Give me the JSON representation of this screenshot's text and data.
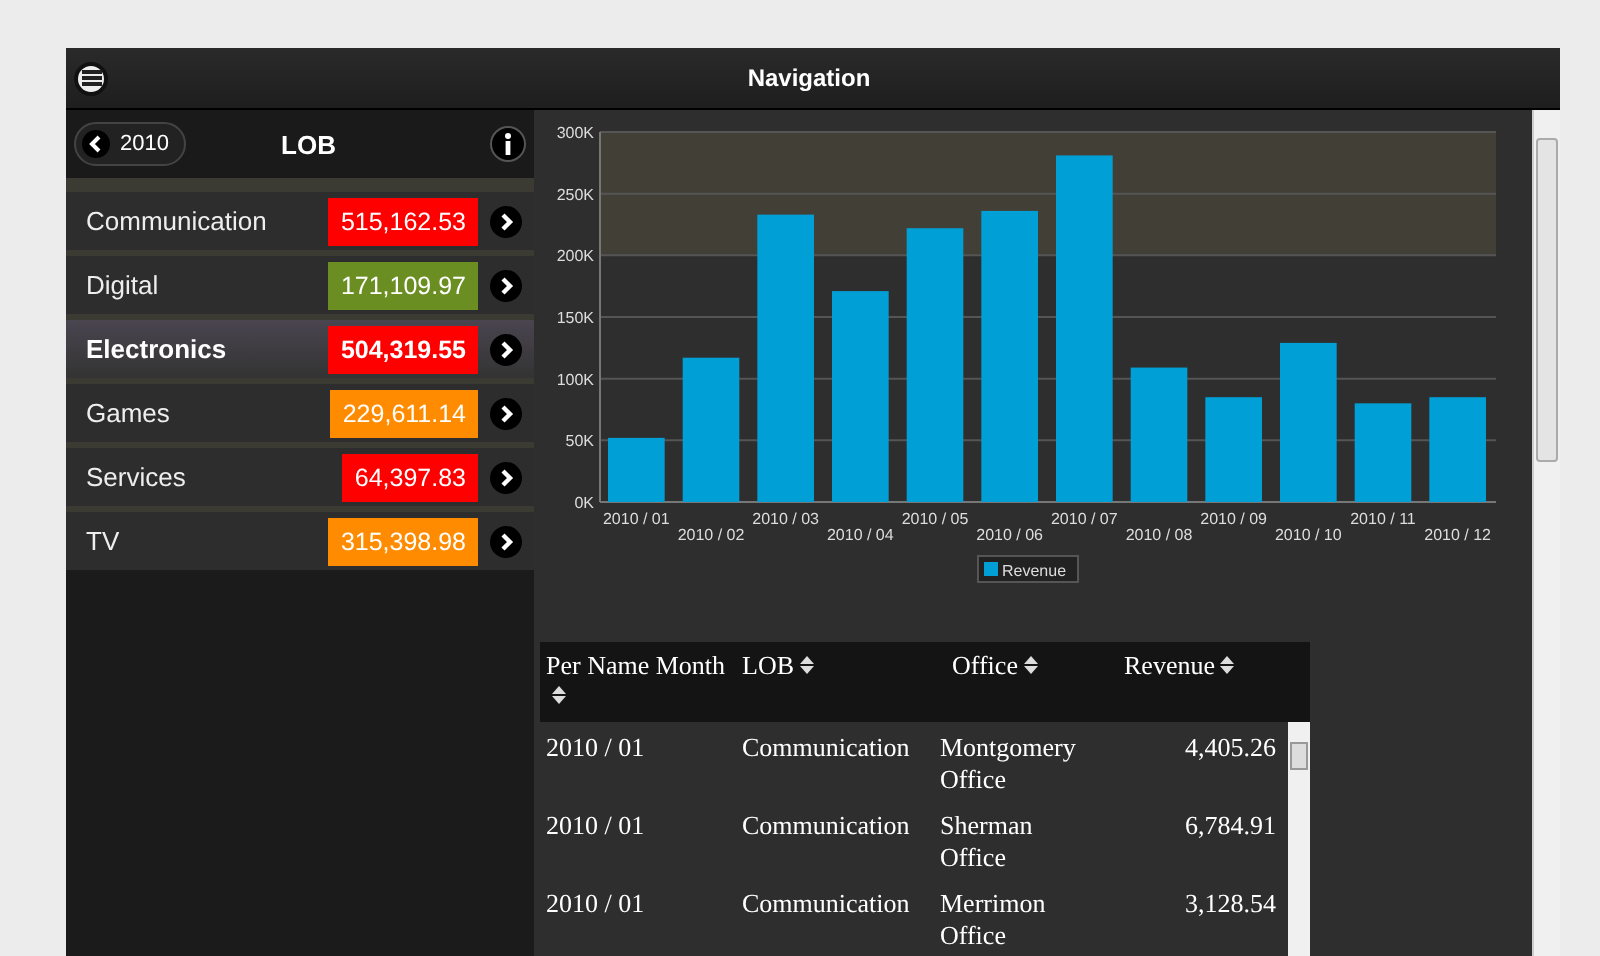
{
  "header": {
    "title": "Navigation"
  },
  "panel": {
    "back_label": "2010",
    "title": "LOB"
  },
  "lob_items": [
    {
      "name": "Communication",
      "value": "515,162.53",
      "color": "#ff0000",
      "selected": false
    },
    {
      "name": "Digital",
      "value": "171,109.97",
      "color": "#6b8e23",
      "selected": false
    },
    {
      "name": "Electronics",
      "value": "504,319.55",
      "color": "#ff0000",
      "selected": true
    },
    {
      "name": "Games",
      "value": "229,611.14",
      "color": "#ff8c00",
      "selected": false
    },
    {
      "name": "Services",
      "value": "64,397.83",
      "color": "#ff0000",
      "selected": false
    },
    {
      "name": "TV",
      "value": "315,398.98",
      "color": "#ff8c00",
      "selected": false
    }
  ],
  "chart": {
    "chart_data": {
      "type": "bar",
      "categories": [
        "2010 / 01",
        "2010 / 02",
        "2010 / 03",
        "2010 / 04",
        "2010 / 05",
        "2010 / 06",
        "2010 / 07",
        "2010 / 08",
        "2010 / 09",
        "2010 / 10",
        "2010 / 11",
        "2010 / 12"
      ],
      "series": [
        {
          "name": "Revenue",
          "color": "#00a0d6",
          "values": [
            52000,
            117000,
            233000,
            171000,
            222000,
            236000,
            281000,
            109000,
            85000,
            129000,
            80000,
            85000
          ]
        }
      ],
      "ylim": [
        0,
        300000
      ],
      "grid": true,
      "yticks": [
        {
          "value": 0,
          "label": "0K"
        },
        {
          "value": 50000,
          "label": "50K"
        },
        {
          "value": 100000,
          "label": "100K"
        },
        {
          "value": 150000,
          "label": "150K"
        },
        {
          "value": 200000,
          "label": "200K"
        },
        {
          "value": 250000,
          "label": "250K"
        },
        {
          "value": 300000,
          "label": "300K"
        }
      ]
    }
  },
  "table": {
    "columns": [
      "Per Name Month",
      "LOB",
      "Office",
      "Revenue"
    ],
    "rows": [
      [
        "2010 / 01",
        "Communication",
        "Montgomery Office",
        "4,405.26"
      ],
      [
        "2010 / 01",
        "Communication",
        "Sherman Office",
        "6,784.91"
      ],
      [
        "2010 / 01",
        "Communication",
        "Merrimon Office",
        "3,128.54"
      ]
    ]
  }
}
